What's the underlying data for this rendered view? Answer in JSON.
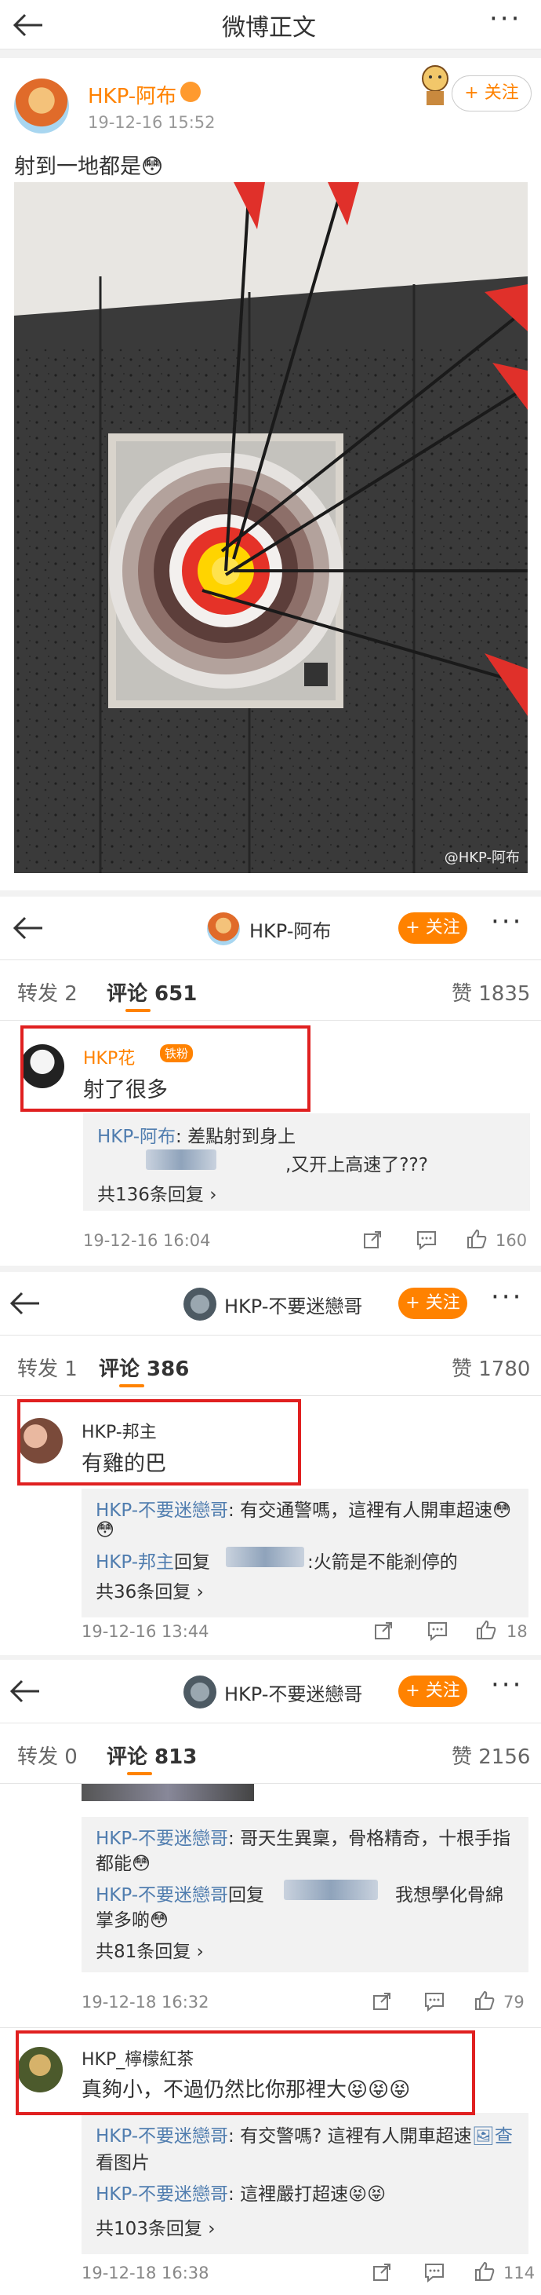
{
  "header": {
    "title": "微博正文"
  },
  "post": {
    "author": "HKP-阿布",
    "time": "19-12-16 15:52",
    "text": "射到一地都是😳",
    "follow_label": "+ 关注",
    "watermark": "@HKP-阿布"
  },
  "sections": [
    {
      "bar_name": "HKP-阿布",
      "follow_label": "+ 关注",
      "tabs": {
        "repost": "转发 2",
        "comments": "评论 651",
        "likes": "赞 1835"
      },
      "comment": {
        "user": "HKP花",
        "badge": "铁粉",
        "text": "射了很多",
        "replies": [
          {
            "user": "HKP-阿布",
            "text": ": 差點射到身上"
          },
          {
            "user": "",
            "text": ",又开上高速了???"
          }
        ],
        "more": "共136条回复 ›",
        "time": "19-12-16 16:04",
        "likes": "160"
      }
    },
    {
      "bar_name": "HKP-不要迷戀哥",
      "follow_label": "+ 关注",
      "tabs": {
        "repost": "转发 1",
        "comments": "评论 386",
        "likes": "赞 1780"
      },
      "comment": {
        "user": "HKP-邦主",
        "text": "有雞的巴",
        "replies": [
          {
            "user": "HKP-不要迷戀哥",
            "text": ": 有交通警嗎，這裡有人開車超速😳"
          },
          {
            "user": "",
            "text": "😳"
          },
          {
            "user": "HKP-邦主",
            "text": "回复",
            "tail": ":火箭是不能剎停的"
          }
        ],
        "more": "共36条回复 ›",
        "time": "19-12-16 13:44",
        "likes": "18"
      }
    },
    {
      "bar_name": "HKP-不要迷戀哥",
      "follow_label": "+ 关注",
      "tabs": {
        "repost": "转发 0",
        "comments": "评论 813",
        "likes": "赞 2156"
      },
      "comment_a": {
        "replies": [
          {
            "user": "HKP-不要迷戀哥",
            "text": ": 哥天生異稟，骨格精奇，十根手指"
          },
          {
            "user": "",
            "text": "都能😳"
          },
          {
            "user": "HKP-不要迷戀哥",
            "text": "回复",
            "tail": "我想學化骨綿"
          },
          {
            "user": "",
            "text": "掌多啲😳"
          }
        ],
        "more": "共81条回复 ›",
        "time": "19-12-18 16:32",
        "likes": "79"
      },
      "comment_b": {
        "user": "HKP_檸檬紅茶",
        "text": "真夠小，不過仍然比你那裡大😝😝😝",
        "replies": [
          {
            "user": "HKP-不要迷戀哥",
            "text": ": 有交警嗎? 這裡有人開車超速",
            "link": "🖼查"
          },
          {
            "user": "",
            "text": "看图片"
          },
          {
            "user": "HKP-不要迷戀哥",
            "text": ": 這裡嚴打超速😝😝"
          }
        ],
        "more": "共103条回复 ›",
        "time": "19-12-18 16:38",
        "likes": "114"
      }
    }
  ],
  "colors": {
    "accent": "#ff8200",
    "link": "#507daf",
    "red_frame": "#e02020"
  }
}
